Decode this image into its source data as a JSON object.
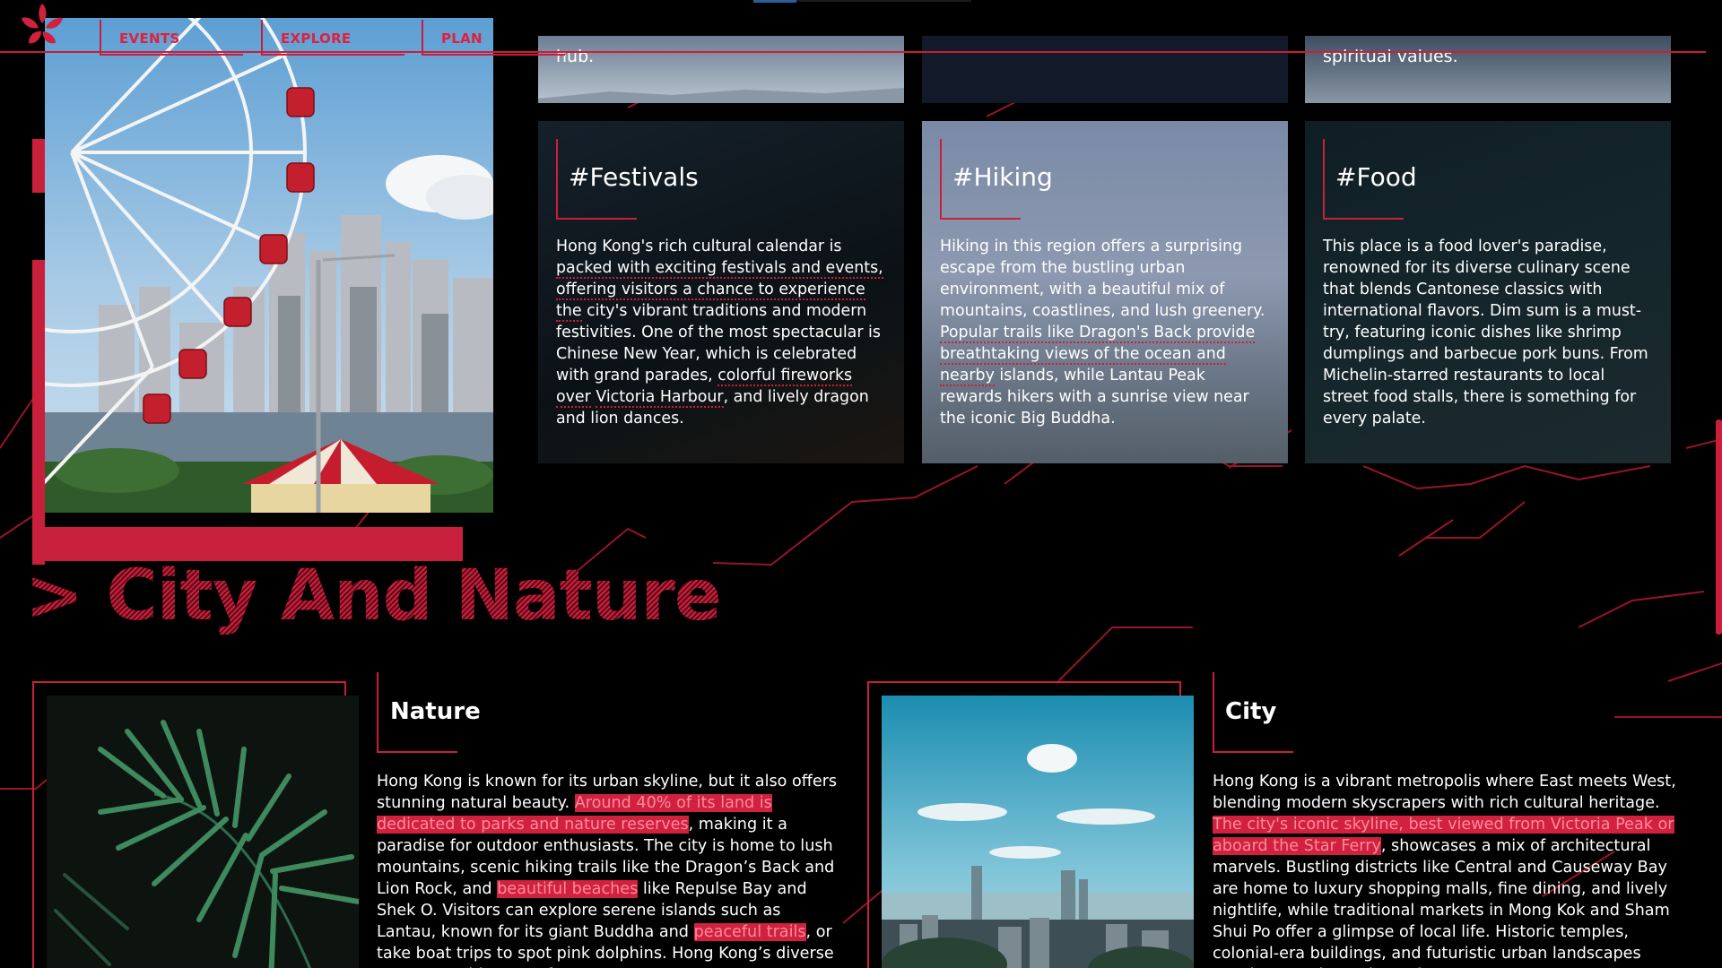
{
  "nav": {
    "logo_icon": "bauhinia-flower-icon",
    "items": [
      {
        "label": "EVENTS"
      },
      {
        "label": "EXPLORE"
      },
      {
        "label": "PLAN"
      }
    ]
  },
  "top_cards": [
    {
      "text": "hub."
    },
    {
      "text": ""
    },
    {
      "text": "spiritual values."
    }
  ],
  "tag_cards": [
    {
      "title": "#Festivals",
      "text_parts": [
        "Hong Kong's rich cultural calendar is ",
        "packed with exciting festivals and events,",
        " ",
        "offering visitors a chance to experience the",
        " city's vibrant traditions and modern festivities. One of the most spectacular is Chinese New Year, which is celebrated with grand parades, ",
        "colorful fireworks over",
        " ",
        "Victoria Harbour",
        ", and lively dragon and lion dances."
      ]
    },
    {
      "title": "#Hiking",
      "text_parts": [
        "Hiking in this region offers a surprising escape from the bustling urban environment, with a beautiful mix of mountains, coastlines, and lush greenery. ",
        "Popular trails like Dragon's Back provide breathtaking views of the ocean and nearby",
        " islands, while Lantau Peak rewards hikers with a sunrise view near the iconic Big Buddha."
      ]
    },
    {
      "title": "#Food",
      "text": "This place is a food lover's paradise, renowned for its diverse culinary scene that blends Cantonese classics with international flavors. Dim sum is a must-try, featuring iconic dishes like shrimp dumplings and barbecue pork buns. From Michelin-starred restaurants to local street food stalls, there is something for every palate."
    }
  ],
  "section": {
    "title": "> City And Nature"
  },
  "nature": {
    "heading": "Nature",
    "p1": "Hong Kong is known for its urban skyline, but it also offers stunning natural beauty. ",
    "h1": "Around 40% of its land is dedicated to parks and nature reserves",
    "p2": ", making it a paradise for outdoor enthusiasts. The city is home to lush mountains, scenic hiking trails like the Dragon’s Back and Lion Rock, and ",
    "h2": "beautiful beaches",
    "p3": " like Repulse Bay and Shek O. Visitors can explore serene islands such as Lantau, known for its giant Buddha and ",
    "h3": "peaceful trails",
    "p4": ", or take boat trips to spot pink dolphins. Hong Kong’s diverse nature provides a perfect"
  },
  "city": {
    "heading": "City",
    "p1": "Hong Kong is a vibrant metropolis where East meets West, blending modern skyscrapers with rich cultural heritage. ",
    "h1": "The city's iconic skyline, best viewed from Victoria Peak or aboard the Star Ferry",
    "p2": ", showcases a mix of architectural marvels. Bustling districts like Central and Causeway Bay are home to luxury shopping malls, fine dining, and lively nightlife, while traditional markets in Mong Kok and Sham Shui Po offer a glimpse of local life. Historic temples, colonial-era buildings, and futuristic urban landscapes coexist, creating a dynamic"
  },
  "colors": {
    "accent": "#c8203c",
    "background": "#000000",
    "text": "#ffffff"
  }
}
